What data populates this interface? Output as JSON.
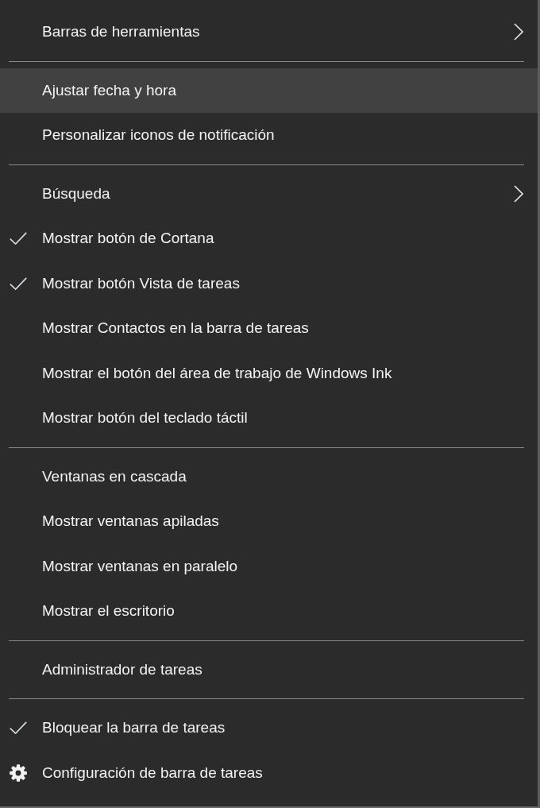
{
  "menu": {
    "groups": [
      {
        "items": [
          {
            "label": "Barras de herramientas",
            "kind": "submenu",
            "checked": false,
            "selected": false
          }
        ]
      },
      {
        "items": [
          {
            "label": "Ajustar fecha y hora",
            "kind": "command",
            "checked": false,
            "selected": true
          },
          {
            "label": "Personalizar iconos de notificación",
            "kind": "command",
            "checked": false,
            "selected": false
          }
        ]
      },
      {
        "items": [
          {
            "label": "Búsqueda",
            "kind": "submenu",
            "checked": false,
            "selected": false
          },
          {
            "label": "Mostrar botón de Cortana",
            "kind": "command",
            "checked": true,
            "selected": false
          },
          {
            "label": "Mostrar botón Vista de tareas",
            "kind": "command",
            "checked": true,
            "selected": false
          },
          {
            "label": "Mostrar Contactos en la barra de tareas",
            "kind": "command",
            "checked": false,
            "selected": false
          },
          {
            "label": "Mostrar el botón del área de trabajo de Windows Ink",
            "kind": "command",
            "checked": false,
            "selected": false
          },
          {
            "label": "Mostrar botón del teclado táctil",
            "kind": "command",
            "checked": false,
            "selected": false
          }
        ]
      },
      {
        "items": [
          {
            "label": "Ventanas en cascada",
            "kind": "command",
            "checked": false,
            "selected": false
          },
          {
            "label": "Mostrar ventanas apiladas",
            "kind": "command",
            "checked": false,
            "selected": false
          },
          {
            "label": "Mostrar ventanas en paralelo",
            "kind": "command",
            "checked": false,
            "selected": false
          },
          {
            "label": "Mostrar el escritorio",
            "kind": "command",
            "checked": false,
            "selected": false
          }
        ]
      },
      {
        "items": [
          {
            "label": "Administrador de tareas",
            "kind": "command",
            "checked": false,
            "selected": false
          }
        ]
      },
      {
        "items": [
          {
            "label": "Bloquear la barra de tareas",
            "kind": "command",
            "checked": true,
            "selected": false
          },
          {
            "label": "Configuración de barra de tareas",
            "kind": "settings",
            "checked": false,
            "selected": false
          }
        ]
      }
    ]
  }
}
